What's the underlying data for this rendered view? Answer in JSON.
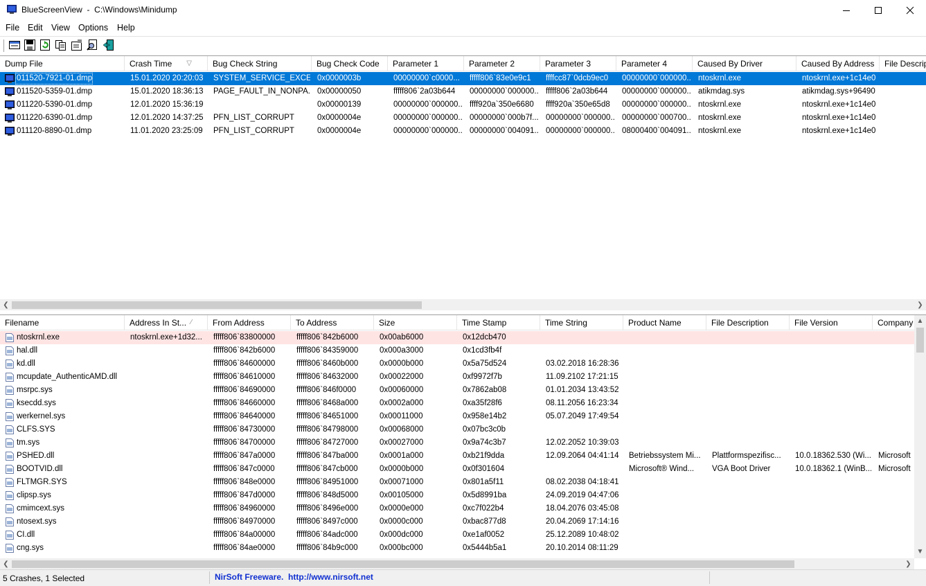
{
  "window": {
    "title": "BlueScreenView  -  C:\\Windows\\Minidump",
    "minimize_glyph": "minimize-icon",
    "maximize_glyph": "maximize-icon",
    "close_glyph": "close-icon"
  },
  "menu": [
    "File",
    "Edit",
    "View",
    "Options",
    "Help"
  ],
  "toolbar": [
    "html-report-icon",
    "save-icon",
    "refresh-icon",
    "copy-icon",
    "properties-icon",
    "find-icon",
    "exit-icon"
  ],
  "top_table": {
    "columns": [
      "Dump File",
      "Crash Time",
      "Bug Check String",
      "Bug Check Code",
      "Parameter 1",
      "Parameter 2",
      "Parameter 3",
      "Parameter 4",
      "Caused By Driver",
      "Caused By Address",
      "File Descrip"
    ],
    "sort_glyph": "▽",
    "rows": [
      [
        "011520-7921-01.dmp",
        "15.01.2020 20:20:03",
        "SYSTEM_SERVICE_EXCEP...",
        "0x0000003b",
        "00000000`c0000...",
        "fffff806`83e0e9c1",
        "ffffcc87`0dcb9ec0",
        "00000000`000000...",
        "ntoskrnl.exe",
        "ntoskrnl.exe+1c14e0",
        ""
      ],
      [
        "011520-5359-01.dmp",
        "15.01.2020 18:36:13",
        "PAGE_FAULT_IN_NONPA...",
        "0x00000050",
        "fffff806`2a03b644",
        "00000000`000000...",
        "fffff806`2a03b644",
        "00000000`000000...",
        "atikmdag.sys",
        "atikmdag.sys+96490",
        ""
      ],
      [
        "011220-5390-01.dmp",
        "12.01.2020 15:36:19",
        "",
        "0x00000139",
        "00000000`000000...",
        "ffff920a`350e6680",
        "ffff920a`350e65d8",
        "00000000`000000...",
        "ntoskrnl.exe",
        "ntoskrnl.exe+1c14e0",
        ""
      ],
      [
        "011220-6390-01.dmp",
        "12.01.2020 14:37:25",
        "PFN_LIST_CORRUPT",
        "0x0000004e",
        "00000000`000000...",
        "00000000`000b7f...",
        "00000000`000000...",
        "00000000`000700...",
        "ntoskrnl.exe",
        "ntoskrnl.exe+1c14e0",
        ""
      ],
      [
        "011120-8890-01.dmp",
        "11.01.2020 23:25:09",
        "PFN_LIST_CORRUPT",
        "0x0000004e",
        "00000000`000000...",
        "00000000`004091...",
        "00000000`000000...",
        "08000400`004091...",
        "ntoskrnl.exe",
        "ntoskrnl.exe+1c14e0",
        ""
      ]
    ]
  },
  "bottom_table": {
    "columns": [
      "Filename",
      "Address In St...",
      "From Address",
      "To Address",
      "Size",
      "Time Stamp",
      "Time String",
      "Product Name",
      "File Description",
      "File Version",
      "Company"
    ],
    "sort_glyph": "⁄",
    "rows": [
      [
        "ntoskrnl.exe",
        "ntoskrnl.exe+1d32...",
        "fffff806`83800000",
        "fffff806`842b6000",
        "0x00ab6000",
        "0x12dcb470",
        "",
        "",
        "",
        "",
        ""
      ],
      [
        "hal.dll",
        "",
        "fffff806`842b6000",
        "fffff806`84359000",
        "0x000a3000",
        "0x1cd3fb4f",
        "",
        "",
        "",
        "",
        ""
      ],
      [
        "kd.dll",
        "",
        "fffff806`84600000",
        "fffff806`8460b000",
        "0x0000b000",
        "0x5a75d524",
        "03.02.2018 16:28:36",
        "",
        "",
        "",
        ""
      ],
      [
        "mcupdate_AuthenticAMD.dll",
        "",
        "fffff806`84610000",
        "fffff806`84632000",
        "0x00022000",
        "0xf9972f7b",
        "11.09.2102 17:21:15",
        "",
        "",
        "",
        ""
      ],
      [
        "msrpc.sys",
        "",
        "fffff806`84690000",
        "fffff806`846f0000",
        "0x00060000",
        "0x7862ab08",
        "01.01.2034 13:43:52",
        "",
        "",
        "",
        ""
      ],
      [
        "ksecdd.sys",
        "",
        "fffff806`84660000",
        "fffff806`8468a000",
        "0x0002a000",
        "0xa35f28f6",
        "08.11.2056 16:23:34",
        "",
        "",
        "",
        ""
      ],
      [
        "werkernel.sys",
        "",
        "fffff806`84640000",
        "fffff806`84651000",
        "0x00011000",
        "0x958e14b2",
        "05.07.2049 17:49:54",
        "",
        "",
        "",
        ""
      ],
      [
        "CLFS.SYS",
        "",
        "fffff806`84730000",
        "fffff806`84798000",
        "0x00068000",
        "0x07bc3c0b",
        "",
        "",
        "",
        "",
        ""
      ],
      [
        "tm.sys",
        "",
        "fffff806`84700000",
        "fffff806`84727000",
        "0x00027000",
        "0x9a74c3b7",
        "12.02.2052 10:39:03",
        "",
        "",
        "",
        ""
      ],
      [
        "PSHED.dll",
        "",
        "fffff806`847a0000",
        "fffff806`847ba000",
        "0x0001a000",
        "0xb21f9dda",
        "12.09.2064 04:41:14",
        "Betriebssystem Mi...",
        "Plattformspezifisc...",
        "10.0.18362.530 (Wi...",
        "Microsoft"
      ],
      [
        "BOOTVID.dll",
        "",
        "fffff806`847c0000",
        "fffff806`847cb000",
        "0x0000b000",
        "0x0f301604",
        "",
        "Microsoft® Wind...",
        "VGA Boot Driver",
        "10.0.18362.1 (WinB...",
        "Microsoft"
      ],
      [
        "FLTMGR.SYS",
        "",
        "fffff806`848e0000",
        "fffff806`84951000",
        "0x00071000",
        "0x801a5f11",
        "08.02.2038 04:18:41",
        "",
        "",
        "",
        ""
      ],
      [
        "clipsp.sys",
        "",
        "fffff806`847d0000",
        "fffff806`848d5000",
        "0x00105000",
        "0x5d8991ba",
        "24.09.2019 04:47:06",
        "",
        "",
        "",
        ""
      ],
      [
        "cmimcext.sys",
        "",
        "fffff806`84960000",
        "fffff806`8496e000",
        "0x0000e000",
        "0xc7f022b4",
        "18.04.2076 03:45:08",
        "",
        "",
        "",
        ""
      ],
      [
        "ntosext.sys",
        "",
        "fffff806`84970000",
        "fffff806`8497c000",
        "0x0000c000",
        "0xbac877d8",
        "20.04.2069 17:14:16",
        "",
        "",
        "",
        ""
      ],
      [
        "CI.dll",
        "",
        "fffff806`84a00000",
        "fffff806`84adc000",
        "0x000dc000",
        "0xe1af0052",
        "25.12.2089 10:48:02",
        "",
        "",
        "",
        ""
      ],
      [
        "cng.sys",
        "",
        "fffff806`84ae0000",
        "fffff806`84b9c000",
        "0x000bc000",
        "0x5444b5a1",
        "20.10.2014 08:11:29",
        "",
        "",
        "",
        ""
      ]
    ]
  },
  "status": {
    "left": "5 Crashes, 1 Selected",
    "link": "NirSoft Freeware.  http://www.nirsoft.net"
  },
  "colors": {
    "selection": "#0078d7",
    "highlight_row": "#ffe4e4",
    "link": "#1030d0"
  }
}
